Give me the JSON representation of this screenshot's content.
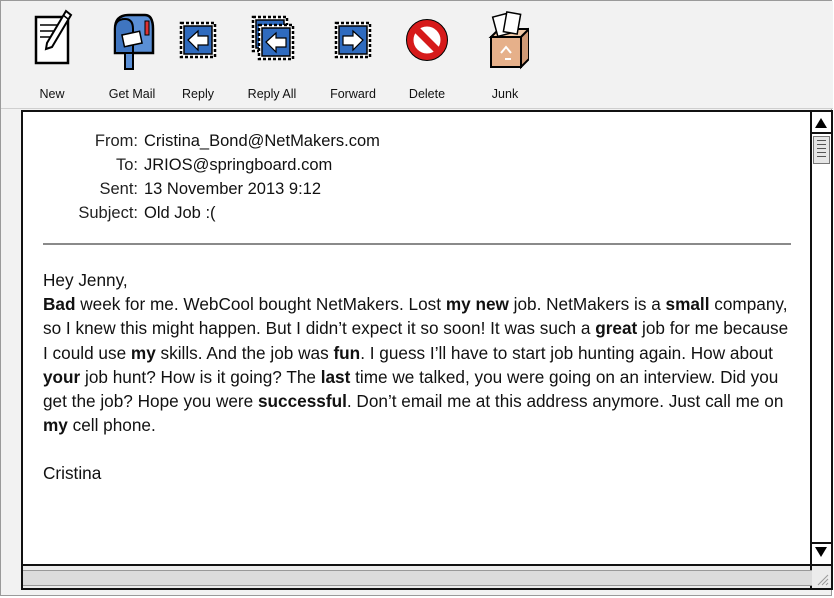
{
  "toolbar": {
    "buttons": [
      {
        "id": "new",
        "label": "New",
        "icon": "pencil-notepad-icon"
      },
      {
        "id": "getmail",
        "label": "Get Mail",
        "icon": "mailbox-icon"
      },
      {
        "id": "reply",
        "label": "Reply",
        "icon": "reply-arrow-icon"
      },
      {
        "id": "replyall",
        "label": "Reply All",
        "icon": "reply-all-arrow-icon"
      },
      {
        "id": "forward",
        "label": "Forward",
        "icon": "forward-arrow-icon"
      },
      {
        "id": "delete",
        "label": "Delete",
        "icon": "no-entry-icon"
      },
      {
        "id": "junk",
        "label": "Junk",
        "icon": "recycle-bin-icon"
      }
    ]
  },
  "message": {
    "from_label": "From:",
    "from": "Cristina_Bond@NetMakers.com",
    "to_label": "To:",
    "to": "JRIOS@springboard.com",
    "sent_label": "Sent:",
    "sent": "13 November 2013 9:12",
    "subject_label": "Subject:",
    "subject": "Old Job :(",
    "greeting": "Hey Jenny,",
    "body_segments": [
      {
        "t": "Bad",
        "b": true
      },
      {
        "t": " week for me. WebCool bought NetMakers. Lost ",
        "b": false
      },
      {
        "t": "my new",
        "b": true
      },
      {
        "t": " job. NetMakers is a ",
        "b": false
      },
      {
        "t": "small",
        "b": true
      },
      {
        "t": " company, so I knew this might happen. But I didn’t expect it so soon! It was such a ",
        "b": false
      },
      {
        "t": "great",
        "b": true
      },
      {
        "t": " job for me because I could use ",
        "b": false
      },
      {
        "t": "my",
        "b": true
      },
      {
        "t": " skills. And the job was ",
        "b": false
      },
      {
        "t": "fun",
        "b": true
      },
      {
        "t": ". I guess I’ll have to start job hunting again. How about ",
        "b": false
      },
      {
        "t": "your",
        "b": true
      },
      {
        "t": " job hunt? How is it going? The ",
        "b": false
      },
      {
        "t": "last",
        "b": true
      },
      {
        "t": " time we talked, you were going on an interview. Did you get the job? Hope you were ",
        "b": false
      },
      {
        "t": "successful",
        "b": true
      },
      {
        "t": ". Don’t email me at this address anymore. Just call me on ",
        "b": false
      },
      {
        "t": "my",
        "b": true
      },
      {
        "t": " cell phone.",
        "b": false
      }
    ],
    "signature": "Cristina"
  },
  "colors": {
    "reply_blue": "#2f6bbf",
    "delete_red": "#d61a1a",
    "pane_border": "#111111"
  }
}
